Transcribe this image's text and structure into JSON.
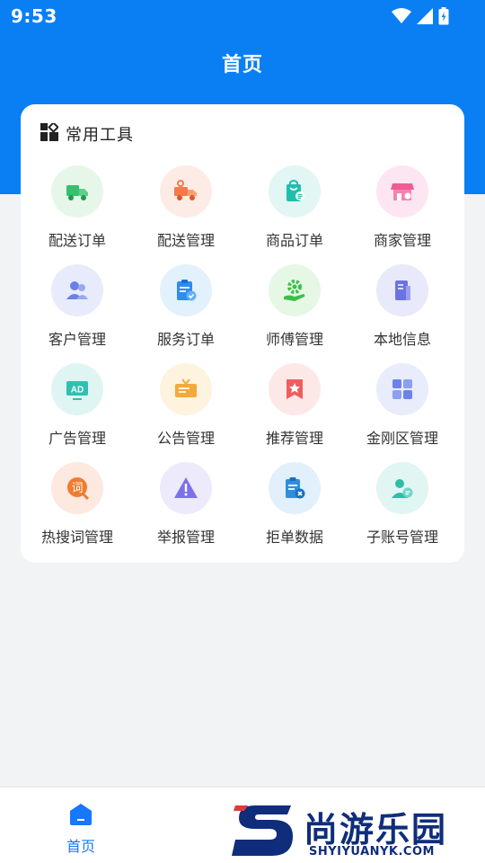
{
  "status_bar": {
    "time": "9:53"
  },
  "header": {
    "title": "首页"
  },
  "card": {
    "title": "常用工具"
  },
  "tools": [
    {
      "label": "配送订单",
      "icon": "truck-icon",
      "bg": "#e6f7ea",
      "color": "#34c26b"
    },
    {
      "label": "配送管理",
      "icon": "delivery-truck-icon",
      "bg": "#fdebe6",
      "color": "#f27a4c"
    },
    {
      "label": "商品订单",
      "icon": "shopping-bag-icon",
      "bg": "#e2f6f4",
      "color": "#1fbfae"
    },
    {
      "label": "商家管理",
      "icon": "storefront-icon",
      "bg": "#fde6f1",
      "color": "#ef5b96"
    },
    {
      "label": "客户管理",
      "icon": "customers-icon",
      "bg": "#e8ebfb",
      "color": "#6d7fe6"
    },
    {
      "label": "服务订单",
      "icon": "service-clipboard-icon",
      "bg": "#e2f1fc",
      "color": "#2f8cf0"
    },
    {
      "label": "师傅管理",
      "icon": "gear-hand-icon",
      "bg": "#e6f7e6",
      "color": "#3cbf4a"
    },
    {
      "label": "本地信息",
      "icon": "local-doc-icon",
      "bg": "#e8eafb",
      "color": "#6b72e8"
    },
    {
      "label": "广告管理",
      "icon": "ad-board-icon",
      "bg": "#dff5f3",
      "color": "#2fc0b1"
    },
    {
      "label": "公告管理",
      "icon": "notice-board-icon",
      "bg": "#fdf3de",
      "color": "#f4a93a"
    },
    {
      "label": "推荐管理",
      "icon": "recommend-star-icon",
      "bg": "#fde8e8",
      "color": "#ef5e5e"
    },
    {
      "label": "金刚区管理",
      "icon": "grid-blocks-icon",
      "bg": "#e8ecfb",
      "color": "#6c82ea"
    },
    {
      "label": "热搜词管理",
      "icon": "hot-word-icon",
      "bg": "#fde9df",
      "color": "#f07c30"
    },
    {
      "label": "举报管理",
      "icon": "warning-icon",
      "bg": "#eceafb",
      "color": "#7b71ea"
    },
    {
      "label": "拒单数据",
      "icon": "reject-clipboard-icon",
      "bg": "#e1f0fb",
      "color": "#2e8fe0"
    },
    {
      "label": "子账号管理",
      "icon": "sub-account-icon",
      "bg": "#e1f5f2",
      "color": "#2ebda8"
    }
  ],
  "bottom_nav": {
    "home_label": "首页"
  },
  "watermark": {
    "text": "尚游乐园",
    "sub": "SHYIYUANYK.COM"
  }
}
